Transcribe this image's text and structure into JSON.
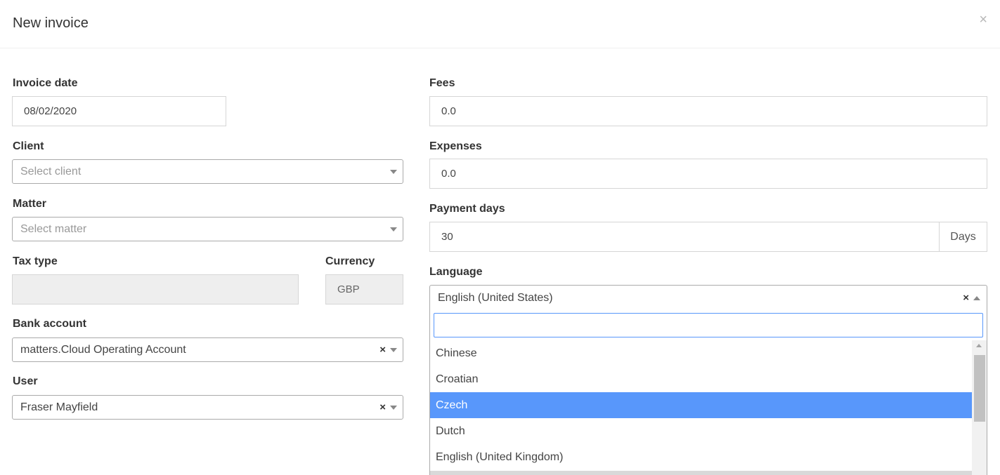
{
  "modal": {
    "title": "New invoice",
    "close": "×"
  },
  "form": {
    "invoice_date": {
      "label": "Invoice date",
      "value": "08/02/2020"
    },
    "client": {
      "label": "Client",
      "placeholder": "Select client"
    },
    "matter": {
      "label": "Matter",
      "placeholder": "Select matter"
    },
    "tax_type": {
      "label": "Tax type",
      "value": ""
    },
    "currency": {
      "label": "Currency",
      "value": "GBP"
    },
    "bank_account": {
      "label": "Bank account",
      "value": "matters.Cloud Operating Account",
      "clear": "×"
    },
    "user": {
      "label": "User",
      "value": "Fraser Mayfield",
      "clear": "×"
    },
    "fees": {
      "label": "Fees",
      "value": "0.0"
    },
    "expenses": {
      "label": "Expenses",
      "value": "0.0"
    },
    "payment_days": {
      "label": "Payment days",
      "value": "30",
      "addon": "Days"
    },
    "language": {
      "label": "Language",
      "value": "English (United States)",
      "clear": "×",
      "search_value": "",
      "options": [
        "Chinese",
        "Croatian",
        "Czech",
        "Dutch",
        "English (United Kingdom)"
      ],
      "highlighted": "Czech"
    }
  }
}
